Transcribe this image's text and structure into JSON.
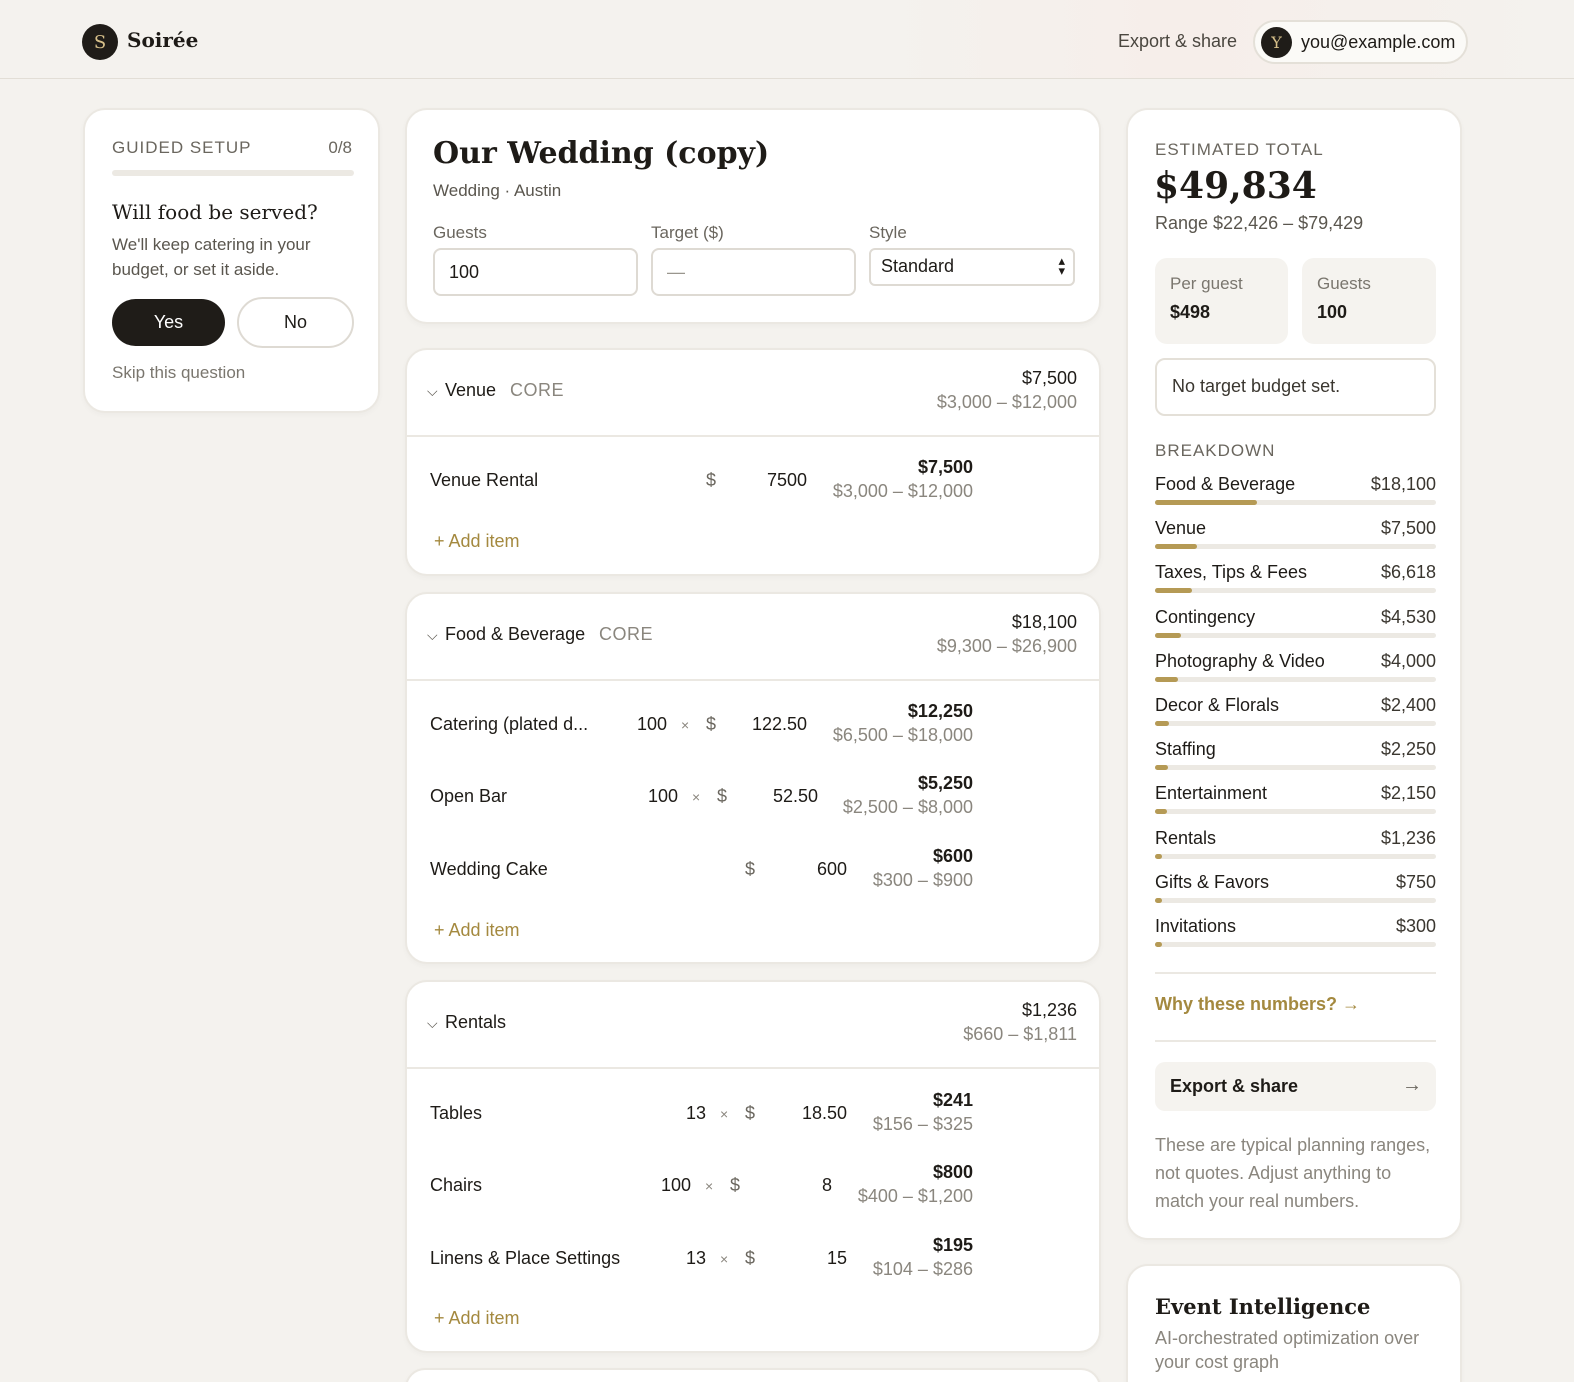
{
  "header": {
    "logo_letter": "S",
    "brand": "Soirée",
    "export_label": "Export & share",
    "user_initial": "Y",
    "user_email": "you@example.com"
  },
  "guided_setup": {
    "title": "GUIDED SETUP",
    "count": "0/8",
    "progress_fraction": 0,
    "question": "Will food be served?",
    "description": "We'll keep catering in your budget, or set it aside.",
    "yes_label": "Yes",
    "no_label": "No",
    "skip_label": "Skip this question"
  },
  "event": {
    "title": "Our Wedding (copy)",
    "subtitle": "Wedding · Austin",
    "guests_label": "Guests",
    "guests_value": "100",
    "target_label": "Target ($)",
    "target_placeholder": "—",
    "style_label": "Style",
    "style_value": "Standard"
  },
  "categories": [
    {
      "name": "Venue",
      "tag": "CORE",
      "total": "$7,500",
      "range": "$3,000 – $12,000",
      "items": [
        {
          "name": "Venue Rental",
          "qty": "",
          "price": "7500",
          "total": "$7,500",
          "range": "$3,000 – $12,000"
        }
      ],
      "add_label": "+ Add item"
    },
    {
      "name": "Food & Beverage",
      "tag": "CORE",
      "total": "$18,100",
      "range": "$9,300 – $26,900",
      "items": [
        {
          "name": "Catering (plated d...",
          "qty": "100",
          "price": "122.50",
          "total": "$12,250",
          "range": "$6,500 – $18,000"
        },
        {
          "name": "Open Bar",
          "qty": "100",
          "price": "52.50",
          "total": "$5,250",
          "range": "$2,500 – $8,000"
        },
        {
          "name": "Wedding Cake",
          "qty": "",
          "price": "600",
          "total": "$600",
          "range": "$300 – $900"
        }
      ],
      "add_label": "+ Add item"
    },
    {
      "name": "Rentals",
      "tag": "",
      "total": "$1,236",
      "range": "$660 – $1,811",
      "items": [
        {
          "name": "Tables",
          "qty": "13",
          "price": "18.50",
          "total": "$241",
          "range": "$156 – $325"
        },
        {
          "name": "Chairs",
          "qty": "100",
          "price": "8",
          "total": "$800",
          "range": "$400 – $1,200"
        },
        {
          "name": "Linens & Place Settings",
          "qty": "13",
          "price": "15",
          "total": "$195",
          "range": "$104 – $286"
        }
      ],
      "add_label": "+ Add item"
    }
  ],
  "line_symbols": {
    "times": "×",
    "dollar": "$"
  },
  "summary": {
    "label": "ESTIMATED TOTAL",
    "total": "$49,834",
    "range": "Range $22,426 – $79,429",
    "per_guest_label": "Per guest",
    "per_guest_value": "$498",
    "guests_label": "Guests",
    "guests_value": "100",
    "target_note": "No target budget set.",
    "breakdown_label": "BREAKDOWN",
    "breakdown": [
      {
        "name": "Food & Beverage",
        "value": "$18,100",
        "amount": 18100
      },
      {
        "name": "Venue",
        "value": "$7,500",
        "amount": 7500
      },
      {
        "name": "Taxes, Tips & Fees",
        "value": "$6,618",
        "amount": 6618
      },
      {
        "name": "Contingency",
        "value": "$4,530",
        "amount": 4530
      },
      {
        "name": "Photography & Video",
        "value": "$4,000",
        "amount": 4000
      },
      {
        "name": "Decor & Florals",
        "value": "$2,400",
        "amount": 2400
      },
      {
        "name": "Staffing",
        "value": "$2,250",
        "amount": 2250
      },
      {
        "name": "Entertainment",
        "value": "$2,150",
        "amount": 2150
      },
      {
        "name": "Rentals",
        "value": "$1,236",
        "amount": 1236
      },
      {
        "name": "Gifts & Favors",
        "value": "$750",
        "amount": 750
      },
      {
        "name": "Invitations",
        "value": "$300",
        "amount": 300
      }
    ],
    "why_link": "Why these numbers? →",
    "export_label": "Export & share",
    "export_arrow": "→",
    "disclaimer": "These are typical planning ranges, not quotes. Adjust anything to match your real numbers."
  },
  "event_intelligence": {
    "title": "Event Intelligence",
    "subtitle": "AI-orchestrated optimization over your cost graph"
  },
  "colors": {
    "accent": "#b59a55",
    "link": "#a4893f",
    "dark": "#1f1c18",
    "background": "#f4f2ee"
  }
}
